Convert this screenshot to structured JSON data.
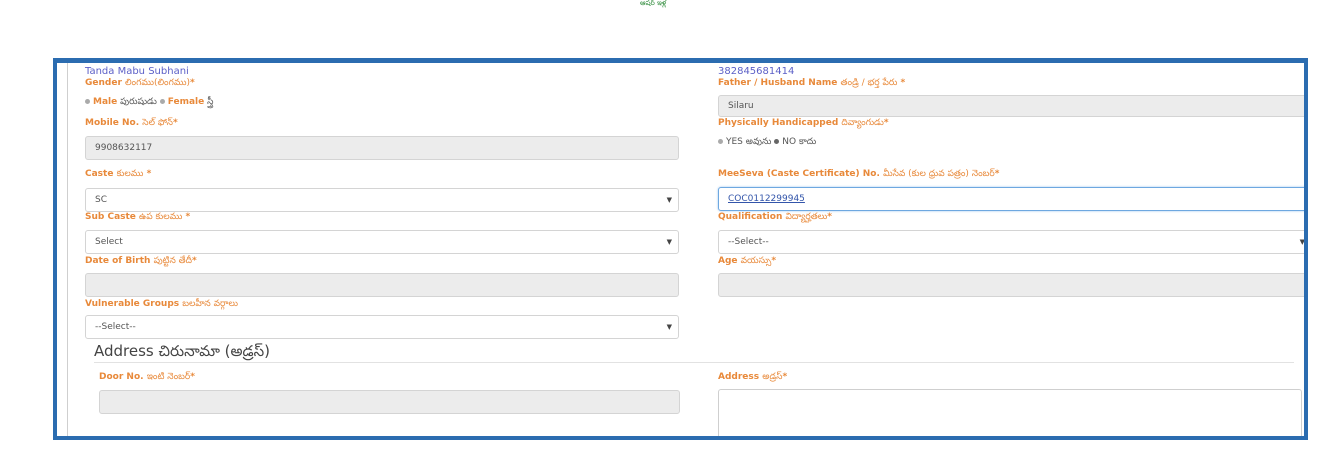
{
  "header": {
    "logo_text": "ఆషర్ ఇళ్ల"
  },
  "applicant": {
    "name": "Tanda Mabu Subhani",
    "id_number": "382845681414"
  },
  "gender": {
    "label": "Gender",
    "label_te": "లింగము(లింగము)",
    "req": "*",
    "options": [
      {
        "en": "Male",
        "te": "పురుషుడు"
      },
      {
        "en": "Female",
        "te": "స్త్రీ"
      }
    ]
  },
  "father": {
    "label": "Father / Husband Name",
    "label_te": "తండ్రి / భర్త పేరు",
    "req": " *",
    "value": "Silaru"
  },
  "mobile": {
    "label": "Mobile No.",
    "label_te": "సెల్ ఫోన్",
    "req": "*",
    "value": "9908632117"
  },
  "handicapped": {
    "label": "Physically Handicapped",
    "label_te": "దివ్యాంగుడు",
    "req": "*",
    "options": [
      {
        "en": "YES",
        "te": "అవును"
      },
      {
        "en": "NO",
        "te": "కాదు"
      }
    ]
  },
  "caste": {
    "label": "Caste",
    "label_te": "కులము",
    "req": " *",
    "value": "SC"
  },
  "meeseva": {
    "label": "MeeSeva (Caste Certificate) No.",
    "label_te": "మీసేవ (కుల ధ్రువ పత్రం) నెంబర్",
    "req": "*",
    "value": "COC0112299945"
  },
  "subcaste": {
    "label": "Sub Caste",
    "label_te": "ఉప కులము",
    "req": " *",
    "value": "Select"
  },
  "qualification": {
    "label": "Qualification",
    "label_te": "విద్యార్హతలు",
    "req": "*",
    "value": "--Select--"
  },
  "dob": {
    "label": "Date of Birth",
    "label_te": "పుట్టిన తేదీ",
    "req": "*",
    "value": ""
  },
  "age": {
    "label": "Age",
    "label_te": "వయస్సు",
    "req": "*",
    "value": ""
  },
  "vulnerable": {
    "label": "Vulnerable Groups",
    "label_te": "బలహీన వర్గాలు",
    "value": "--Select--"
  },
  "address_section": {
    "title": "Address చిరునామా (అడ్రస్)"
  },
  "door": {
    "label": "Door No.",
    "label_te": "ఇంటి నెంబర్",
    "req": "*",
    "value": ""
  },
  "address": {
    "label": "Address",
    "label_te": "అడ్రస్",
    "req": "*",
    "value": ""
  }
}
